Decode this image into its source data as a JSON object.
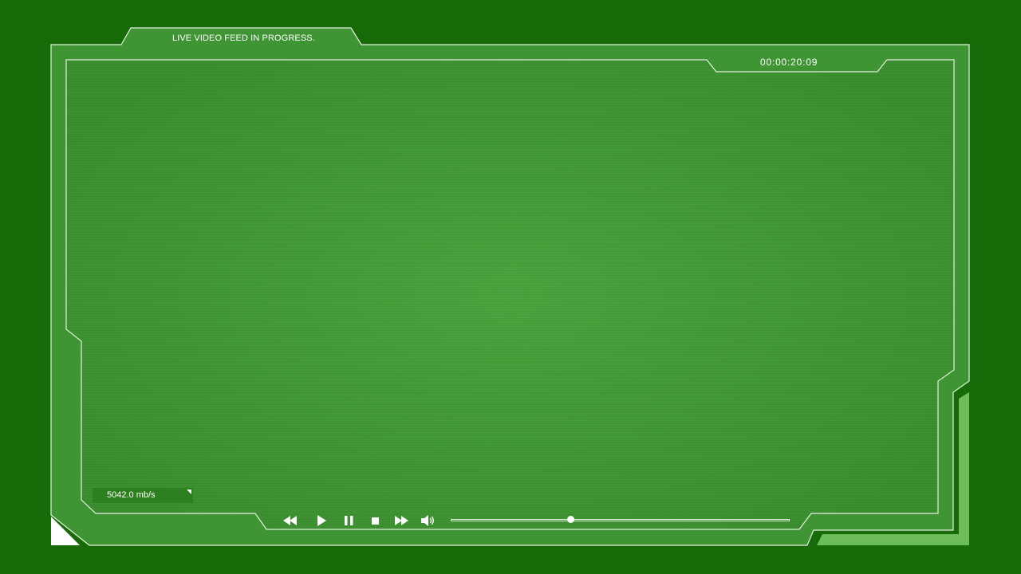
{
  "player": {
    "feed_status": "LIVE VIDEO FEED IN PROGRESS.",
    "timecode": "00:00:20:09",
    "bitrate": "5042.0 mb/s",
    "progress_fraction": 0.355
  },
  "controls": [
    {
      "name": "rewind-button",
      "icon": "rewind-icon"
    },
    {
      "name": "play-button",
      "icon": "play-icon"
    },
    {
      "name": "pause-button",
      "icon": "pause-icon"
    },
    {
      "name": "stop-button",
      "icon": "stop-icon"
    },
    {
      "name": "fast-forward-button",
      "icon": "fast-forward-icon"
    },
    {
      "name": "volume-button",
      "icon": "volume-icon"
    }
  ],
  "colors": {
    "background": "#166b08",
    "panel": "#3f9434",
    "line": "#e6f2e0",
    "accent": "#6dbd5a"
  }
}
